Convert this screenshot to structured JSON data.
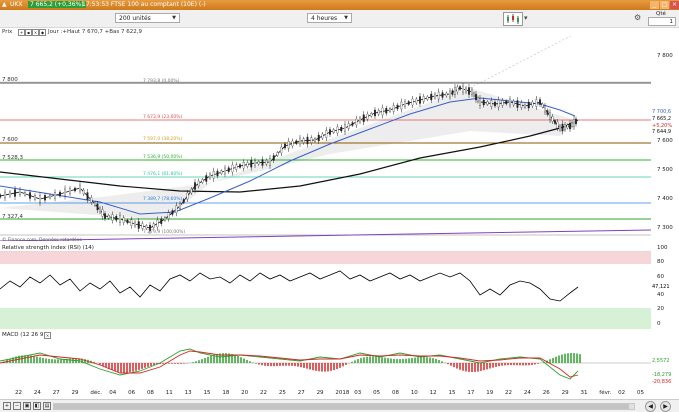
{
  "window": {
    "title": "UKX",
    "quote": "7 665,2 (+0,36%)",
    "quote_detail": "17:53:53 FTSE 100 au comptant (10E) (-)",
    "buttons": [
      "_",
      "□",
      "×"
    ]
  },
  "toolbar": {
    "units_select": "200 unités",
    "interval_select": "4 heures",
    "qte_label": "Qté",
    "qte_value": "1"
  },
  "info": {
    "prix_label": "Prix",
    "ohlc": "Jour :+Haut 7 670,7 +Bas 7 622,9"
  },
  "price_axis": {
    "ticks": [
      "7 800",
      "7 700,6",
      "7 665,2",
      "+5,20%",
      "7 644,9",
      "7 600",
      "7 500",
      "7 400",
      "7 300"
    ],
    "left_levels": [
      "7 800",
      "7 600",
      "7 528,3",
      "7 327,4"
    ]
  },
  "fib_levels": [
    {
      "label": "7 793,8 (0,00%)",
      "color": "#7a7a7a"
    },
    {
      "label": "7 673,9 (23,60%)",
      "color": "#e05050"
    },
    {
      "label": "7 597,0 (38,20%)",
      "color": "#d4a020"
    },
    {
      "label": "7 536,9 (50,00%)",
      "color": "#30b030"
    },
    {
      "label": "7 476,1 (61,80%)",
      "color": "#30c8a0"
    },
    {
      "label": "7 389,7 (78,60%)",
      "color": "#3080e0"
    },
    {
      "label": "7 279,9 (100,00%)",
      "color": "#7a7a7a"
    }
  ],
  "source_note": "© Finance.com, Données retardées",
  "rsi": {
    "title": "Relative strength index (RSI) (14)",
    "ticks": [
      "100",
      "80",
      "60",
      "47,121",
      "40",
      "20",
      "0"
    ]
  },
  "macd": {
    "title": "MACD (12 26 9)",
    "ticks": [
      "2,5572",
      "-18,279",
      "-20,836"
    ]
  },
  "x_axis": {
    "dates": [
      "22",
      "24",
      "27",
      "29",
      "déc.",
      "04",
      "06",
      "08",
      "11",
      "13",
      "15",
      "18",
      "20",
      "22",
      "25",
      "27",
      "29",
      "2018",
      "03",
      "05",
      "08",
      "10",
      "12",
      "15",
      "17",
      "19",
      "22",
      "24",
      "26",
      "29",
      "31",
      "févr.",
      "02",
      "05"
    ]
  },
  "colors": {
    "titlebar": "#d9852a",
    "price_candle": "#222222",
    "ma_blue": "#3a5fcd",
    "ma_black": "#111111",
    "rsi_line": "#000000",
    "macd_pos": "#2ca02c",
    "macd_neg": "#d62728"
  },
  "icons": {
    "chart_type": "candlestick-icon",
    "settings": "gear-icon",
    "nav_prev": "arrow-left-icon",
    "nav_next": "arrow-right-icon"
  }
}
